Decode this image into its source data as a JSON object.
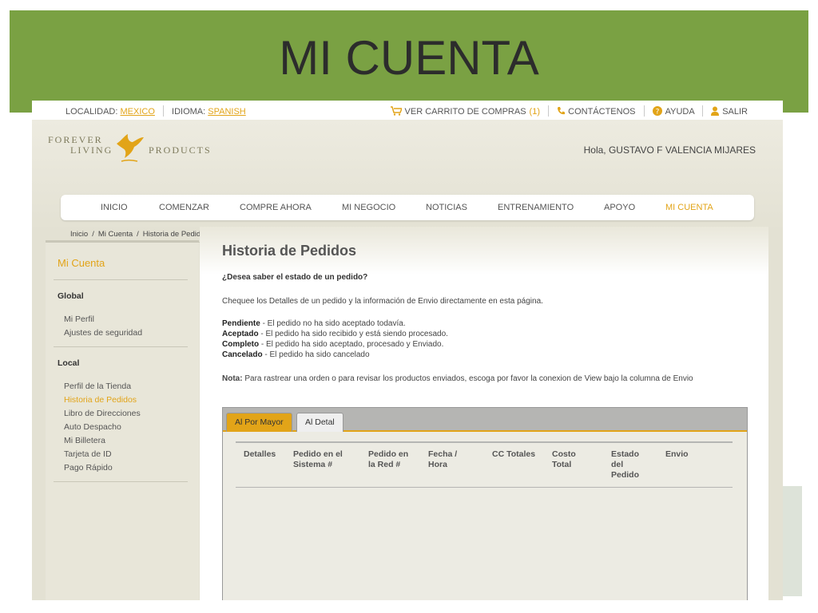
{
  "slide": {
    "title": "MI CUENTA"
  },
  "topbar": {
    "localidad_label": "LOCALIDAD:",
    "localidad_value": "MEXICO",
    "idioma_label": "IDIOMA:",
    "idioma_value": "SPANISH",
    "cart_label": "VER CARRITO DE COMPRAS",
    "cart_count": "(1)",
    "contact_label": "CONTÁCTENOS",
    "help_label": "AYUDA",
    "logout_label": "SALIR"
  },
  "logo": {
    "word1": "FOREVER",
    "word2": "LIVING",
    "word3": "PRODUCTS"
  },
  "greeting": "Hola, GUSTAVO F VALENCIA MIJARES",
  "nav": [
    {
      "label": "INICIO",
      "active": false
    },
    {
      "label": "COMENZAR",
      "active": false
    },
    {
      "label": "COMPRE AHORA",
      "active": false
    },
    {
      "label": "MI NEGOCIO",
      "active": false
    },
    {
      "label": "NOTICIAS",
      "active": false
    },
    {
      "label": "ENTRENAMIENTO",
      "active": false
    },
    {
      "label": "APOYO",
      "active": false
    },
    {
      "label": "MI CUENTA",
      "active": true
    }
  ],
  "breadcrumb": [
    "Inicio",
    "Mi Cuenta",
    "Historia de Pedidos"
  ],
  "sidebar": {
    "title": "Mi Cuenta",
    "global_heading": "Global",
    "global_links": [
      "Mi Perfil",
      "Ajustes de seguridad"
    ],
    "local_heading": "Local",
    "local_links": [
      "Perfil de la Tienda",
      "Historia de Pedidos",
      "Libro de Direcciones",
      "Auto Despacho",
      "Mi Billetera",
      "Tarjeta de ID",
      "Pago Rápido"
    ],
    "active_link": "Historia de Pedidos"
  },
  "main": {
    "title": "Historia de Pedidos",
    "question": "¿Desea saber el estado de un pedido?",
    "intro": "Chequee los Detalles de un pedido y la información de Envio directamente en esta página.",
    "statuses": [
      {
        "term": "Pendiente",
        "desc": " - El pedido no ha sido aceptado todavía."
      },
      {
        "term": "Aceptado",
        "desc": " - El pedido ha sido recibido y está siendo procesado."
      },
      {
        "term": "Completo",
        "desc": " - El pedido ha sido aceptado, procesado y Enviado."
      },
      {
        "term": "Cancelado",
        "desc": " - El pedido ha sido cancelado"
      }
    ],
    "nota_label": "Nota:",
    "nota_text": " Para rastrear una orden o para revisar los productos enviados, escoga por favor la conexion de View bajo la columna de Envio",
    "tabs": [
      {
        "label": "Al Por Mayor",
        "active": true
      },
      {
        "label": "Al Detal",
        "active": false
      }
    ],
    "columns": [
      "Detalles",
      "Pedido en el\nSistema #",
      "Pedido en\nla Red #",
      "Fecha /\nHora",
      "CC Totales",
      "Costo\nTotal",
      "Estado\ndel\nPedido",
      "Envio"
    ]
  },
  "colors": {
    "banner": "#7aa143",
    "accent": "#e2a418",
    "page_bg": "#e3e1d3"
  }
}
